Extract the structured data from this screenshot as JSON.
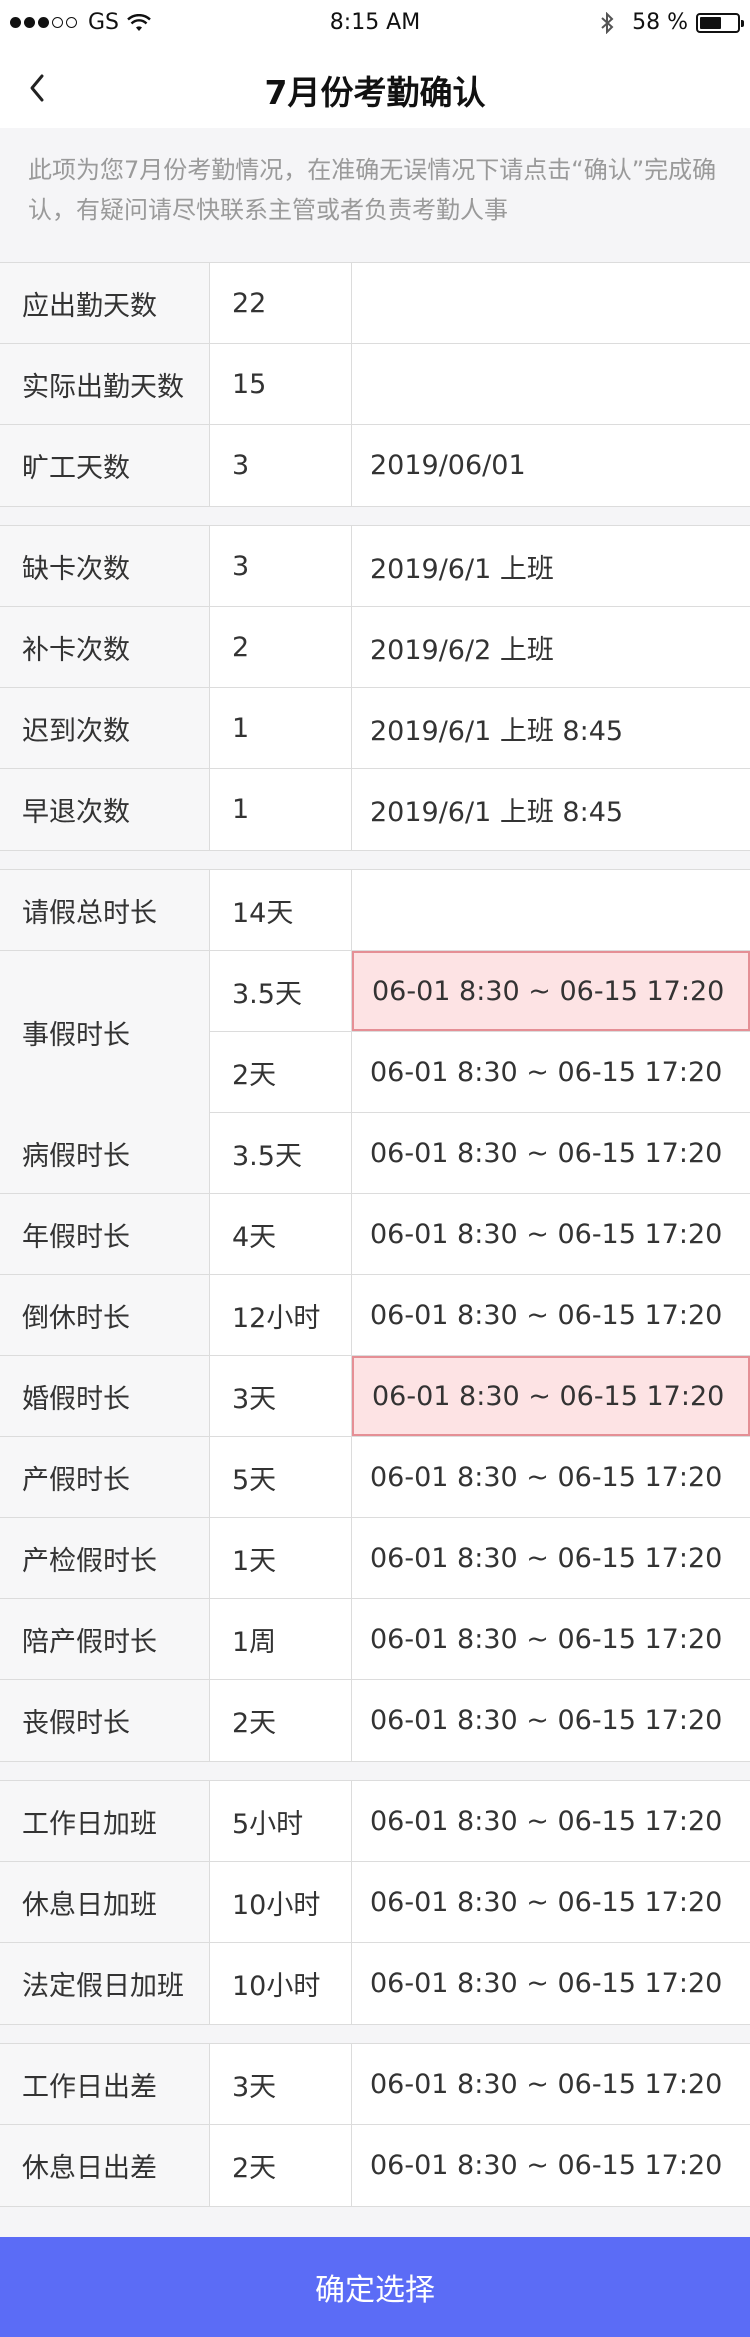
{
  "status_bar": {
    "carrier": "GS",
    "time": "8:15 AM",
    "battery_pct": "58 %",
    "battery_level": 0.58
  },
  "nav": {
    "title": "7月份考勤确认",
    "back_icon": "chevron-left-icon"
  },
  "notice": "此项为您7月份考勤情况，在准确无误情况下请点击“确认”完成确认，有疑问请尽快联系主管或者负责考勤人事",
  "groups": [
    [
      {
        "label": "应出勤天数",
        "value": "22",
        "detail": ""
      },
      {
        "label": "实际出勤天数",
        "value": "15",
        "detail": ""
      },
      {
        "label": "旷工天数",
        "value": "3",
        "detail": "2019/06/01"
      }
    ],
    [
      {
        "label": "缺卡次数",
        "value": "3",
        "detail": "2019/6/1  上班"
      },
      {
        "label": "补卡次数",
        "value": "2",
        "detail": "2019/6/2  上班"
      },
      {
        "label": "迟到次数",
        "value": "1",
        "detail": "2019/6/1  上班   8:45"
      },
      {
        "label": "早退次数",
        "value": "1",
        "detail": "2019/6/1  上班   8:45"
      }
    ],
    {
      "total": {
        "label": "请假总时长",
        "value": "14天",
        "detail": ""
      },
      "personal": {
        "label": "事假时长",
        "entries": [
          {
            "value": "3.5天",
            "detail": "06-01 8:30 ~ 06-15 17:20",
            "highlight": true
          },
          {
            "value": "2天",
            "detail": "06-01 8:30 ~ 06-15 17:20",
            "highlight": false
          }
        ]
      },
      "rows": [
        {
          "label": "病假时长",
          "value": "3.5天",
          "detail": "06-01 8:30 ~ 06-15 17:20",
          "highlight": false
        },
        {
          "label": "年假时长",
          "value": "4天",
          "detail": "06-01 8:30 ~ 06-15 17:20",
          "highlight": false
        },
        {
          "label": "倒休时长",
          "value": "12小时",
          "detail": "06-01 8:30 ~ 06-15 17:20",
          "highlight": false
        },
        {
          "label": "婚假时长",
          "value": "3天",
          "detail": "06-01 8:30 ~ 06-15 17:20",
          "highlight": true
        },
        {
          "label": "产假时长",
          "value": "5天",
          "detail": "06-01 8:30 ~ 06-15 17:20",
          "highlight": false
        },
        {
          "label": "产检假时长",
          "value": "1天",
          "detail": "06-01 8:30 ~ 06-15 17:20",
          "highlight": false
        },
        {
          "label": "陪产假时长",
          "value": "1周",
          "detail": "06-01 8:30 ~ 06-15 17:20",
          "highlight": false
        },
        {
          "label": "丧假时长",
          "value": "2天",
          "detail": "06-01 8:30 ~ 06-15 17:20",
          "highlight": false
        }
      ]
    },
    [
      {
        "label": "工作日加班",
        "value": "5小时",
        "detail": "06-01 8:30 ~ 06-15 17:20"
      },
      {
        "label": "休息日加班",
        "value": "10小时",
        "detail": "06-01 8:30 ~ 06-15 17:20"
      },
      {
        "label": "法定假日加班",
        "value": "10小时",
        "detail": "06-01 8:30 ~ 06-15 17:20"
      }
    ],
    [
      {
        "label": "工作日出差",
        "value": "3天",
        "detail": "06-01 8:30 ~ 06-15 17:20"
      },
      {
        "label": "休息日出差",
        "value": "2天",
        "detail": "06-01 8:30 ~ 06-15 17:20"
      }
    ]
  ],
  "confirm_label": "确定选择",
  "colors": {
    "accent": "#5b6cf6",
    "highlight_bg": "#fde3e4",
    "highlight_border": "#e58f95"
  }
}
